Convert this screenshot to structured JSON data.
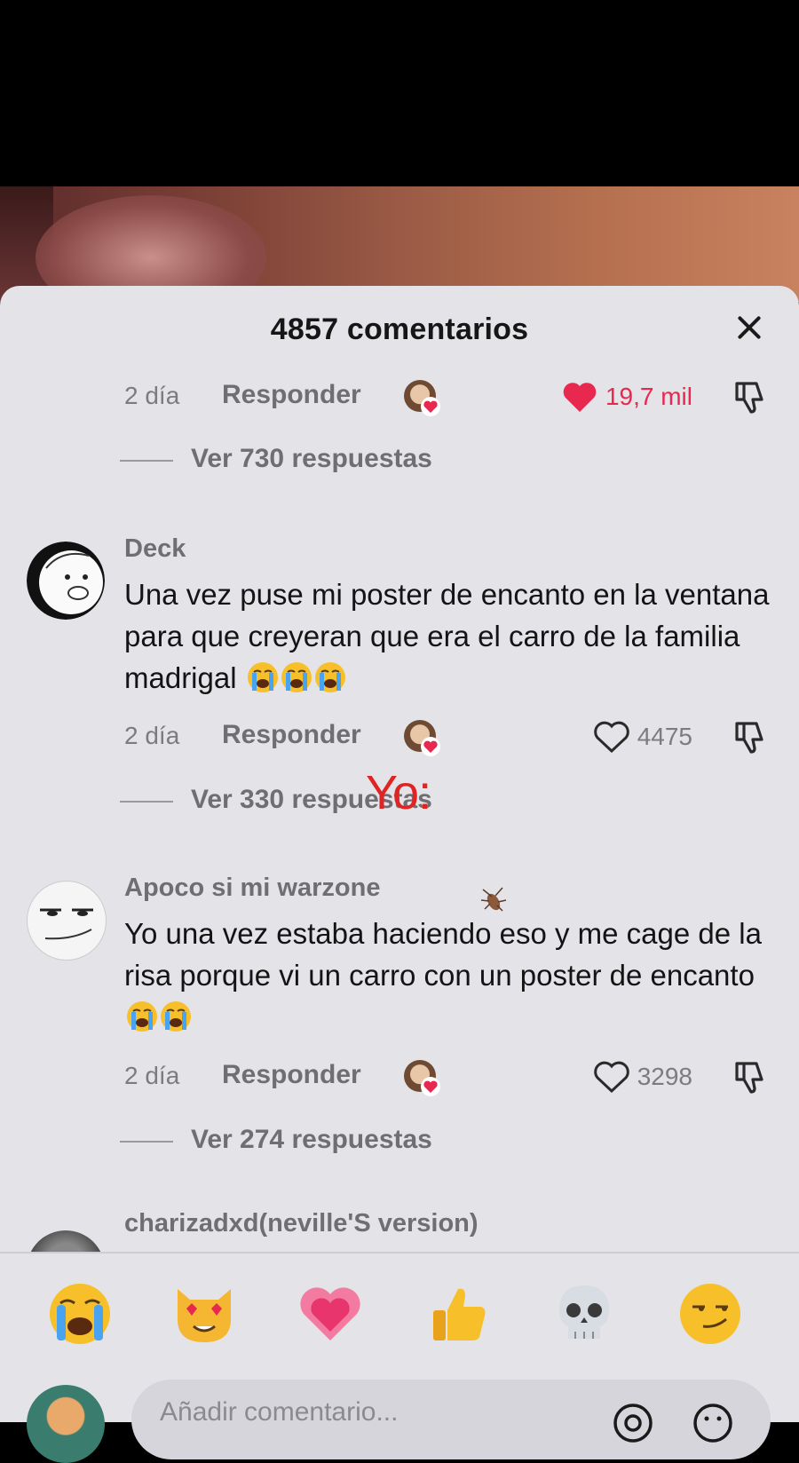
{
  "header": {
    "comment_count_label": "4857 comentarios",
    "close_icon": "close-icon"
  },
  "first_comment_meta": {
    "time": "2 día",
    "reply_label": "Responder",
    "likes": "19,7 mil",
    "liked": true,
    "view_replies": "Ver 730 respuestas"
  },
  "comments": [
    {
      "username": "Deck",
      "text": "Una vez puse mi poster de encanto en la ventana para que creyeran que era el carro de la familia madrigal",
      "emoji_count": 3,
      "time": "2 día",
      "reply_label": "Responder",
      "likes": "4475",
      "view_replies": "Ver 330 respuestas"
    },
    {
      "username": "Apoco si mi warzone",
      "text": "Yo una vez estaba haciendo eso y me cage de la risa porque vi un carro con un poster de encanto",
      "emoji_count": 2,
      "time": "2 día",
      "reply_label": "Responder",
      "likes": "3298",
      "view_replies": "Ver 274 respuestas"
    },
    {
      "username": "charizadxd(neville'S version)"
    }
  ],
  "overlay": {
    "text": "Yo:",
    "color": "#e02424"
  },
  "emoji_bar": [
    "loudly-crying-face",
    "heart-eyes-cat",
    "growing-heart",
    "thumbs-up",
    "skull",
    "smirking-face"
  ],
  "composer": {
    "placeholder": "Añadir comentario..."
  },
  "colors": {
    "like_red": "#e8284f",
    "sheet_bg": "#e4e3e8"
  }
}
